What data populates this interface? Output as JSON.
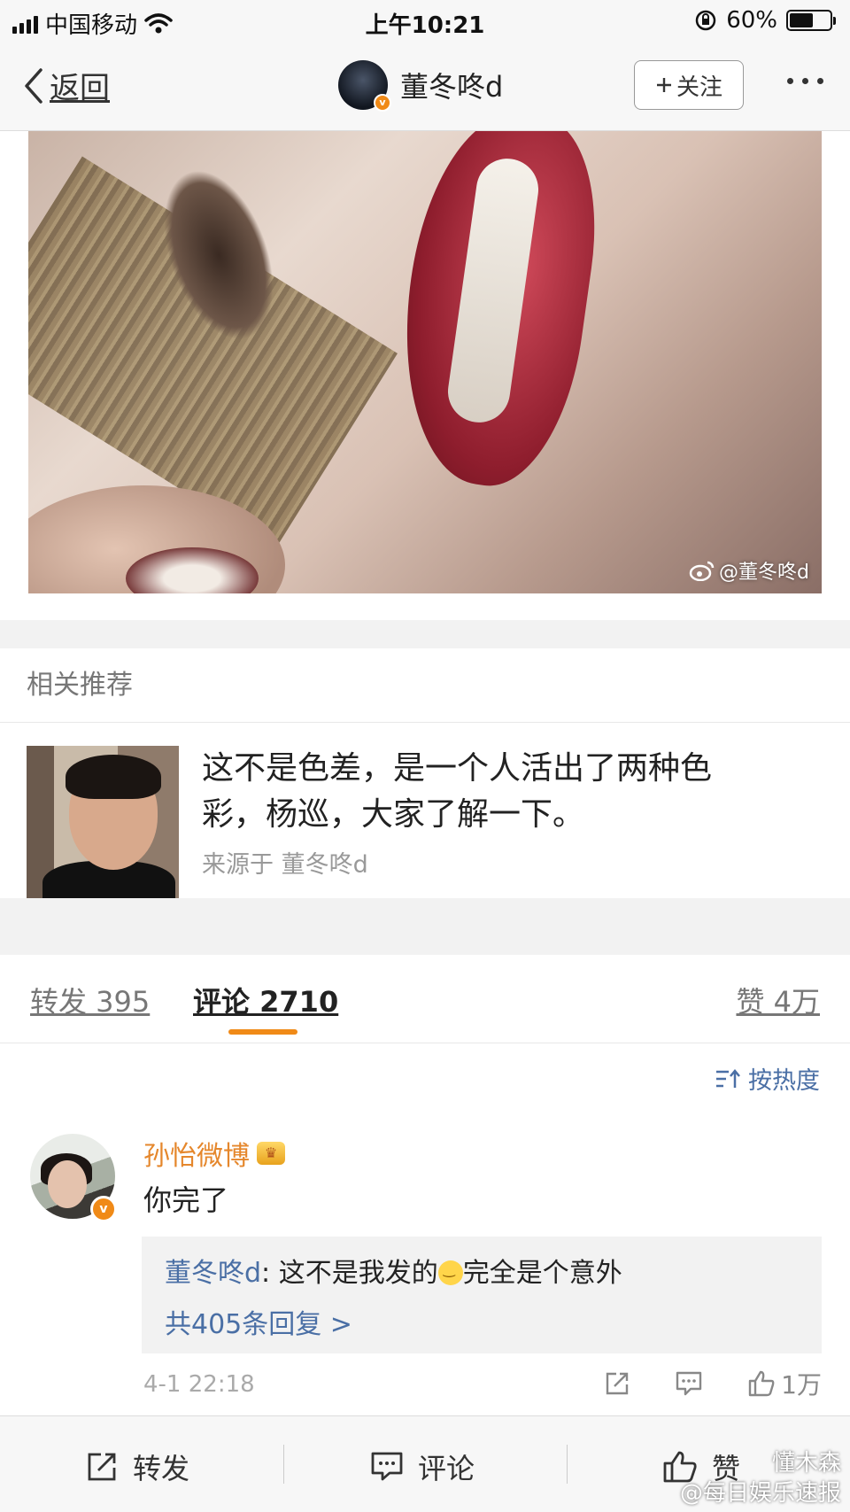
{
  "status_bar": {
    "carrier": "中国移动",
    "time": "上午10:21",
    "battery": "60%",
    "battery_level": 0.6
  },
  "nav": {
    "back_label": "返回",
    "user_name": "董冬咚d",
    "follow_label": "关注"
  },
  "post_image": {
    "watermark": "@董冬咚d"
  },
  "related": {
    "header": "相关推荐",
    "item": {
      "title": "这不是色差，是一个人活出了两种色彩，杨巡，大家了解一下。",
      "source": "来源于 董冬咚d"
    }
  },
  "tabs": {
    "repost": "转发 395",
    "comment": "评论 2710",
    "like": "赞 4万"
  },
  "comments": {
    "sort_label": "按热度",
    "items": [
      {
        "name": "孙怡微博",
        "text": "你完了",
        "reply": {
          "author": "董冬咚d",
          "text_before": ": 这不是我发的",
          "text_after": "完全是个意外",
          "more": "共405条回复 >"
        },
        "time": "4-1 22:18",
        "likes": "1万"
      }
    ]
  },
  "bottom_bar": {
    "repost": "转发",
    "comment": "评论",
    "like": "赞"
  },
  "footer_watermark": {
    "line1": "懂木森",
    "line2": "@每日娱乐速报"
  },
  "colors": {
    "accent": "#f08a17",
    "link": "#4a6fa5",
    "username": "#e5872c"
  }
}
